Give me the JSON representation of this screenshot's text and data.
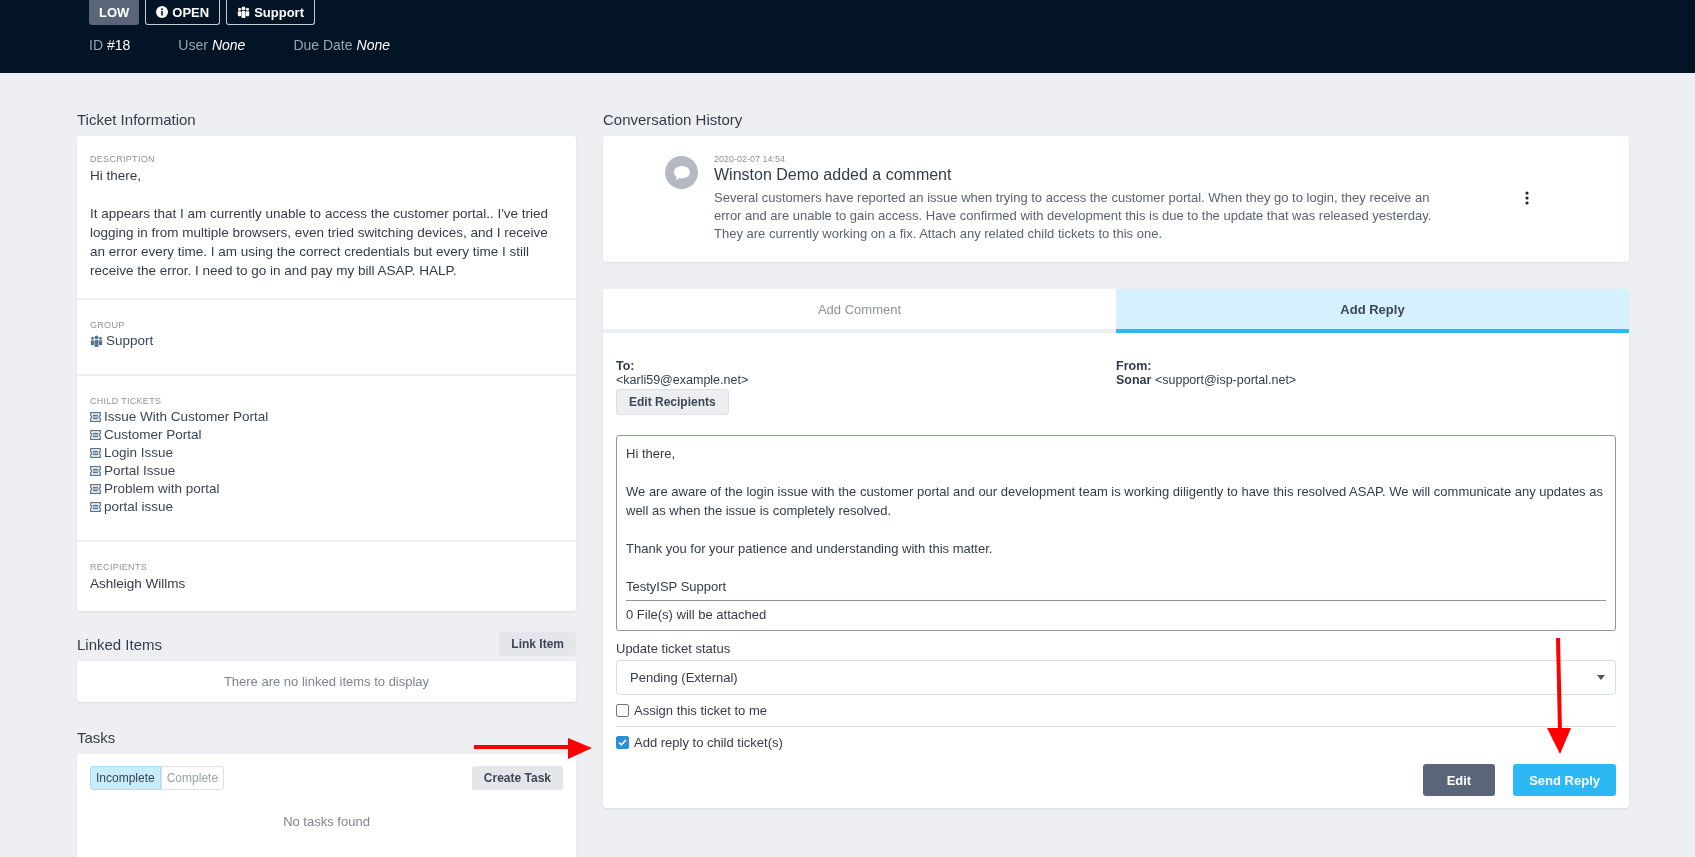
{
  "header": {
    "badges": [
      {
        "kind": "priority",
        "label": "LOW"
      },
      {
        "kind": "status",
        "label": "OPEN"
      },
      {
        "kind": "group",
        "label": "Support"
      }
    ],
    "meta": [
      {
        "label": "ID",
        "value": "#18",
        "italic": false
      },
      {
        "label": "User",
        "value": "None",
        "italic": true
      },
      {
        "label": "Due Date",
        "value": "None",
        "italic": true
      }
    ]
  },
  "ticket_information": {
    "title": "Ticket Information",
    "description": {
      "label": "DESCRIPTION",
      "text": "Hi there,\n\nIt appears that I am currently unable to access the customer portal.. I've tried logging in from multiple browsers, even tried switching devices, and I receive an error every time. I am using the correct credentials but every time I still receive the error. I need to go in and pay my bill ASAP. HALP."
    },
    "group": {
      "label": "GROUP",
      "value": "Support"
    },
    "child_tickets": {
      "label": "CHILD TICKETS",
      "items": [
        "Issue With Customer Portal",
        "Customer Portal",
        "Login Issue",
        "Portal Issue",
        "Problem with portal",
        "portal issue"
      ]
    },
    "recipients": {
      "label": "RECIPIENTS",
      "value": "Ashleigh Willms"
    }
  },
  "linked_items": {
    "title": "Linked Items",
    "button": "Link Item",
    "empty": "There are no linked items to display"
  },
  "tasks": {
    "title": "Tasks",
    "filters": [
      {
        "label": "Incomplete",
        "selected": true
      },
      {
        "label": "Complete",
        "selected": false
      }
    ],
    "button": "Create Task",
    "empty": "No tasks found"
  },
  "conversation": {
    "title": "Conversation History",
    "entries": [
      {
        "time": "2020-02-07 14:54",
        "title": "Winston Demo added a comment",
        "text": "Several customers have reported an issue when trying to access the customer portal. When they go to login, they receive an error and are unable to gain access. Have confirmed with development this is due to the update that was released yesterday. They are currently working on a fix. Attach any related child tickets to this one."
      }
    ]
  },
  "reply": {
    "tabs": [
      {
        "label": "Add Comment",
        "selected": false
      },
      {
        "label": "Add Reply",
        "selected": true
      }
    ],
    "to": {
      "label": "To:",
      "value": "<karli59@example.net>",
      "button": "Edit Recipients"
    },
    "from": {
      "label": "From:",
      "name": "Sonar",
      "value": "<support@isp-portal.net>"
    },
    "message": "Hi there,\n\nWe are aware of the login issue with the customer portal and our development team is working diligently to have this resolved ASAP. We will communicate any updates as well as when the issue is completely resolved.\n\nThank you for your patience and understanding with this matter.\n\nTestyISP Support",
    "attachments": "0 File(s) will be attached",
    "status_label": "Update ticket status",
    "status_value": "Pending (External)",
    "options": [
      {
        "label": "Assign this ticket to me",
        "checked": false
      },
      {
        "label": "Add reply to child ticket(s)",
        "checked": true
      }
    ],
    "buttons": [
      {
        "kind": "secondary",
        "label": "Edit"
      },
      {
        "kind": "primary",
        "label": "Send Reply"
      }
    ]
  }
}
